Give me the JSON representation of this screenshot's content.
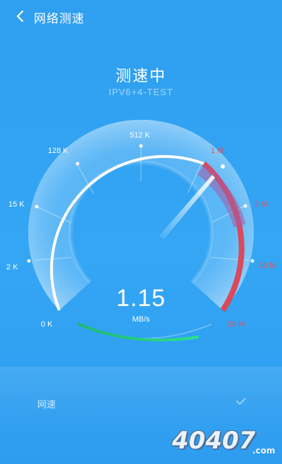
{
  "topbar": {
    "title": "网络测速",
    "back_icon": "chevron-left-icon"
  },
  "test": {
    "status": "测速中",
    "server": "IPV6+4-TEST"
  },
  "gauge": {
    "ticks": [
      {
        "label": "0 K",
        "danger": false
      },
      {
        "label": "2 K",
        "danger": false
      },
      {
        "label": "15 K",
        "danger": false
      },
      {
        "label": "128 K",
        "danger": false
      },
      {
        "label": "512 K",
        "danger": false
      },
      {
        "label": "1 M",
        "danger": true
      },
      {
        "label": "2 M",
        "danger": true
      },
      {
        "label": "10 M",
        "danger": true
      },
      {
        "label": "20 M",
        "danger": true
      }
    ],
    "colors": {
      "normal_label": "#ffffff",
      "danger_label": "#e8505b",
      "danger_arc": "#d84a5c",
      "progress_arc": "#20c97a"
    }
  },
  "speed": {
    "value": "1.15",
    "unit": "MB/s"
  },
  "result": {
    "label": "网速",
    "status_icon": "check-icon"
  },
  "watermark": {
    "text": "40407",
    "suffix": ".com"
  }
}
